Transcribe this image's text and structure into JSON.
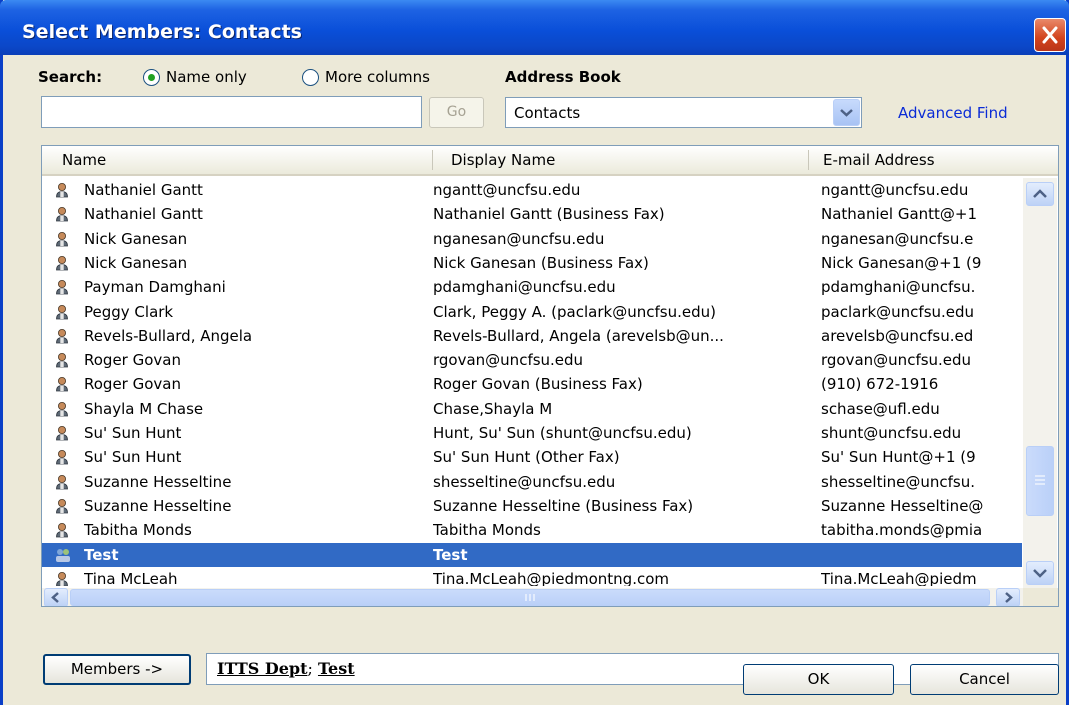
{
  "window": {
    "title": "Select Members: Contacts"
  },
  "search": {
    "label": "Search:",
    "option_name_only": "Name only",
    "option_more_columns": "More columns",
    "selected_option": "Name only",
    "input_value": "",
    "go_label": "Go"
  },
  "address_book": {
    "label": "Address Book",
    "selected": "Contacts",
    "advanced_find": "Advanced Find"
  },
  "columns": [
    "Name",
    "Display Name",
    "E-mail Address"
  ],
  "rows": [
    {
      "name": "Nathaniel Gantt",
      "display": "ngantt@uncfsu.edu",
      "email": "ngantt@uncfsu.edu",
      "icon": "contact-icon"
    },
    {
      "name": "Nathaniel Gantt",
      "display": "Nathaniel Gantt (Business Fax)",
      "email": "Nathaniel Gantt@+1",
      "icon": "contact-icon"
    },
    {
      "name": "Nick Ganesan",
      "display": "nganesan@uncfsu.edu",
      "email": "nganesan@uncfsu.e",
      "icon": "contact-icon"
    },
    {
      "name": "Nick Ganesan",
      "display": "Nick Ganesan (Business Fax)",
      "email": "Nick Ganesan@+1 (9",
      "icon": "contact-icon"
    },
    {
      "name": "Payman Damghani",
      "display": "pdamghani@uncfsu.edu",
      "email": "pdamghani@uncfsu.",
      "icon": "contact-icon"
    },
    {
      "name": "Peggy Clark",
      "display": "Clark, Peggy A. (paclark@uncfsu.edu)",
      "email": "paclark@uncfsu.edu",
      "icon": "contact-icon"
    },
    {
      "name": "Revels-Bullard, Angela",
      "display": "Revels-Bullard, Angela (arevelsb@un...",
      "email": "arevelsb@uncfsu.ed",
      "icon": "contact-icon"
    },
    {
      "name": "Roger Govan",
      "display": "rgovan@uncfsu.edu",
      "email": "rgovan@uncfsu.edu",
      "icon": "contact-icon"
    },
    {
      "name": "Roger Govan",
      "display": "Roger Govan (Business Fax)",
      "email": "(910) 672-1916",
      "icon": "contact-icon"
    },
    {
      "name": "Shayla M Chase",
      "display": "Chase,Shayla M",
      "email": "schase@ufl.edu",
      "icon": "contact-icon"
    },
    {
      "name": "Su' Sun Hunt",
      "display": "Hunt, Su' Sun (shunt@uncfsu.edu)",
      "email": "shunt@uncfsu.edu",
      "icon": "contact-icon"
    },
    {
      "name": "Su' Sun Hunt",
      "display": "Su' Sun Hunt (Other Fax)",
      "email": "Su' Sun Hunt@+1 (9",
      "icon": "contact-icon"
    },
    {
      "name": "Suzanne Hesseltine",
      "display": "shesseltine@uncfsu.edu",
      "email": "shesseltine@uncfsu.",
      "icon": "contact-icon"
    },
    {
      "name": "Suzanne Hesseltine",
      "display": "Suzanne Hesseltine (Business Fax)",
      "email": "Suzanne Hesseltine@",
      "icon": "contact-icon"
    },
    {
      "name": "Tabitha Monds",
      "display": "Tabitha Monds",
      "email": "tabitha.monds@pmia",
      "icon": "contact-icon"
    },
    {
      "name": "Test",
      "display": "Test",
      "email": "",
      "icon": "distribution-list-icon",
      "selected": true
    },
    {
      "name": "Tina McLeah",
      "display": "Tina.McLeah@piedmontng.com",
      "email": "Tina.McLeah@piedm",
      "icon": "contact-icon"
    }
  ],
  "members": {
    "button_label": "Members ->",
    "entries": [
      "ITTS Dept",
      "Test"
    ]
  },
  "buttons": {
    "ok": "OK",
    "cancel": "Cancel"
  },
  "colors": {
    "selection": "#316AC5",
    "title_bar": "#0A4FD9",
    "dialog_bg": "#ECE9D8",
    "link": "#0A2BD6"
  }
}
